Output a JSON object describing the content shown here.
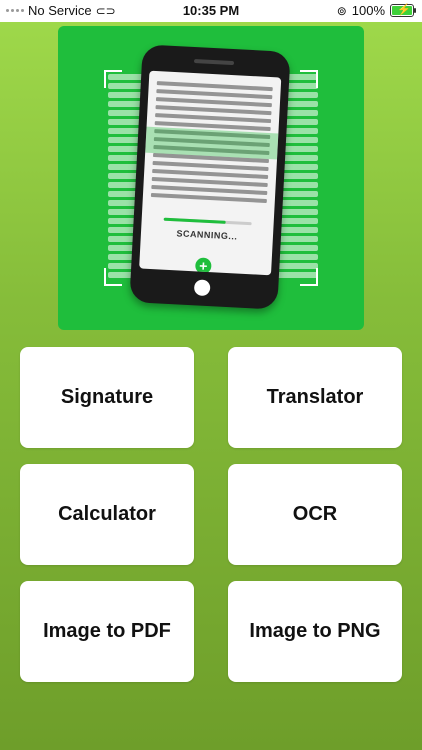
{
  "status_bar": {
    "carrier": "No Service",
    "time": "10:35 PM",
    "battery": "100%"
  },
  "banner": {
    "scanning_text": "SCANNING...",
    "progress": 0.7,
    "accent_color": "#1fbe3c"
  },
  "tiles": [
    {
      "label": "Signature"
    },
    {
      "label": "Translator"
    },
    {
      "label": "Calculator"
    },
    {
      "label": "OCR"
    },
    {
      "label": "Image to PDF"
    },
    {
      "label": "Image to PNG"
    }
  ]
}
